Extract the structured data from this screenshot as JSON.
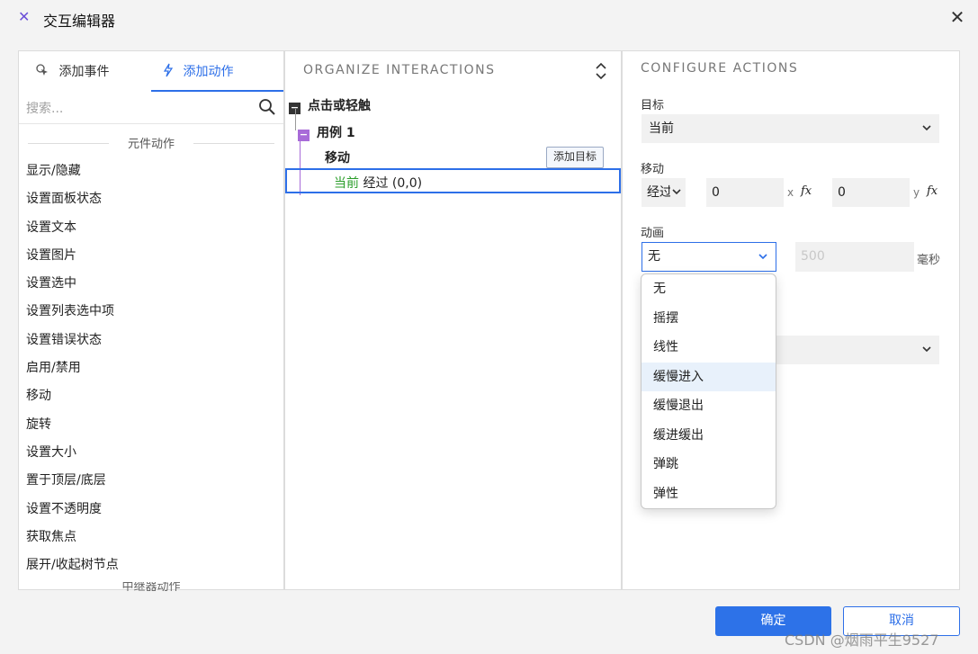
{
  "window": {
    "title": "交互编辑器",
    "close_glyph": "✕",
    "logo_glyph": "✕"
  },
  "left": {
    "tabs": [
      {
        "label": "添加事件"
      },
      {
        "label": "添加动作"
      }
    ],
    "search_placeholder": "搜索...",
    "section": "元件动作",
    "actions": [
      "显示/隐藏",
      "设置面板状态",
      "设置文本",
      "设置图片",
      "设置选中",
      "设置列表选中项",
      "设置错误状态",
      "启用/禁用",
      "移动",
      "旋转",
      "设置大小",
      "置于顶层/底层",
      "设置不透明度",
      "获取焦点",
      "展开/收起树节点"
    ],
    "next_section": "中继器动作"
  },
  "middle": {
    "header": "ORGANIZE INTERACTIONS",
    "event": {
      "box": "−",
      "label": "点击或轻触"
    },
    "case": {
      "box": "−",
      "label": "用例 1"
    },
    "action": "移动",
    "add_target_label": "添加目标",
    "detail": {
      "target": "当前",
      "text": " 经过 (0,0)"
    }
  },
  "right": {
    "header": "CONFIGURE ACTIONS",
    "target_label": "目标",
    "target_value": "当前",
    "move_label": "移动",
    "move_mode": "经过",
    "x_value": "0",
    "x_axis": "x",
    "y_value": "0",
    "y_axis": "y",
    "fx": "fx",
    "anim_label": "动画",
    "anim_value": "无",
    "ms_value": "500",
    "ms_unit": "毫秒"
  },
  "dropdown": {
    "options": [
      "无",
      "摇摆",
      "线性",
      "缓慢进入",
      "缓慢退出",
      "缓进缓出",
      "弹跳",
      "弹性"
    ],
    "highlighted": "缓慢进入"
  },
  "footer": {
    "ok": "确定",
    "cancel": "取消"
  },
  "watermark": "CSDN @烟雨平生9527",
  "colors": {
    "accent": "#2d6fe8",
    "case_purple": "#a86bd8",
    "target_green": "#2a9d2a"
  }
}
